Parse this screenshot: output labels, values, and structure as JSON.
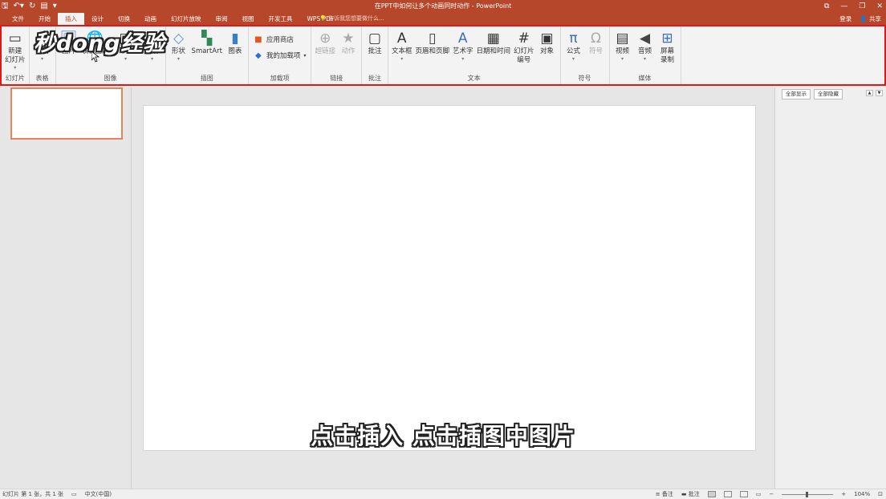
{
  "titlebar": {
    "title": "在PPT中如何让多个动画同时动作 - PowerPoint",
    "qat": {
      "save": "🖫",
      "undo": "↶▾",
      "redo": "↻",
      "start": "▤",
      "more": "▾"
    },
    "window": {
      "restore": "⧉",
      "minimize": "—",
      "maximize": "❐",
      "close": "✕"
    }
  },
  "tabs": [
    "文件",
    "开始",
    "插入",
    "设计",
    "切换",
    "动画",
    "幻灯片放映",
    "审阅",
    "视图",
    "开发工具",
    "WPS PDF"
  ],
  "active_tab": "插入",
  "tellme": "告诉我您想要做什么...",
  "account": {
    "login": "登录",
    "share": "共享"
  },
  "ribbon": {
    "groups": [
      {
        "name": "幻灯片",
        "buttons": [
          {
            "label": "新建\n幻灯片",
            "icon": "new-slide-icon",
            "caret": "▾"
          }
        ]
      },
      {
        "name": "表格",
        "buttons": [
          {
            "label": "表格",
            "icon": "table-icon",
            "caret": "▾"
          }
        ]
      },
      {
        "name": "图像",
        "buttons": [
          {
            "label": "图片",
            "icon": "picture-icon"
          },
          {
            "label": "联机图片",
            "icon": "online-picture-icon"
          },
          {
            "label": "屏幕截图",
            "icon": "screenshot-icon",
            "caret": "▾"
          },
          {
            "label": "相册",
            "icon": "album-icon",
            "caret": "▾"
          }
        ]
      },
      {
        "name": "插图",
        "buttons": [
          {
            "label": "形状",
            "icon": "shapes-icon",
            "caret": "▾"
          },
          {
            "label": "SmartArt",
            "icon": "smartart-icon"
          },
          {
            "label": "图表",
            "icon": "chart-icon"
          }
        ]
      },
      {
        "name": "加载项",
        "small": [
          {
            "label": "应用商店",
            "icon": "store-icon"
          },
          {
            "label": "我的加载项",
            "icon": "addins-icon",
            "caret": "▾"
          }
        ]
      },
      {
        "name": "链接",
        "buttons": [
          {
            "label": "超链接",
            "icon": "hyperlink-icon",
            "disabled": true
          },
          {
            "label": "动作",
            "icon": "action-icon",
            "disabled": true
          }
        ]
      },
      {
        "name": "批注",
        "buttons": [
          {
            "label": "批注",
            "icon": "comment-icon"
          }
        ]
      },
      {
        "name": "文本",
        "buttons": [
          {
            "label": "文本框",
            "icon": "textbox-icon",
            "caret": "▾"
          },
          {
            "label": "页眉和页脚",
            "icon": "header-footer-icon"
          },
          {
            "label": "艺术字",
            "icon": "wordart-icon",
            "caret": "▾"
          },
          {
            "label": "日期和时间",
            "icon": "datetime-icon"
          },
          {
            "label": "幻灯片\n编号",
            "icon": "slide-number-icon"
          },
          {
            "label": "对象",
            "icon": "object-icon"
          }
        ]
      },
      {
        "name": "符号",
        "buttons": [
          {
            "label": "公式",
            "icon": "equation-icon",
            "caret": "▾"
          },
          {
            "label": "符号",
            "icon": "symbol-icon",
            "disabled": true
          }
        ]
      },
      {
        "name": "媒体",
        "buttons": [
          {
            "label": "视频",
            "icon": "video-icon",
            "caret": "▾"
          },
          {
            "label": "音频",
            "icon": "audio-icon",
            "caret": "▾"
          },
          {
            "label": "屏幕\n录制",
            "icon": "screen-record-icon"
          }
        ]
      }
    ]
  },
  "watermark": "秒dong经验",
  "subtitle": "点击插入 点击插图中图片",
  "rightpanel": {
    "show_all": "全部显示",
    "hide_all": "全部隐藏"
  },
  "statusbar": {
    "slide_info": "幻灯片 第 1 张，共 1 张",
    "language": "中文(中国)",
    "notes": "备注",
    "comments": "批注",
    "zoom": "104%"
  },
  "colors": {
    "accent": "#b7472a",
    "highlight_border": "#e01818"
  }
}
